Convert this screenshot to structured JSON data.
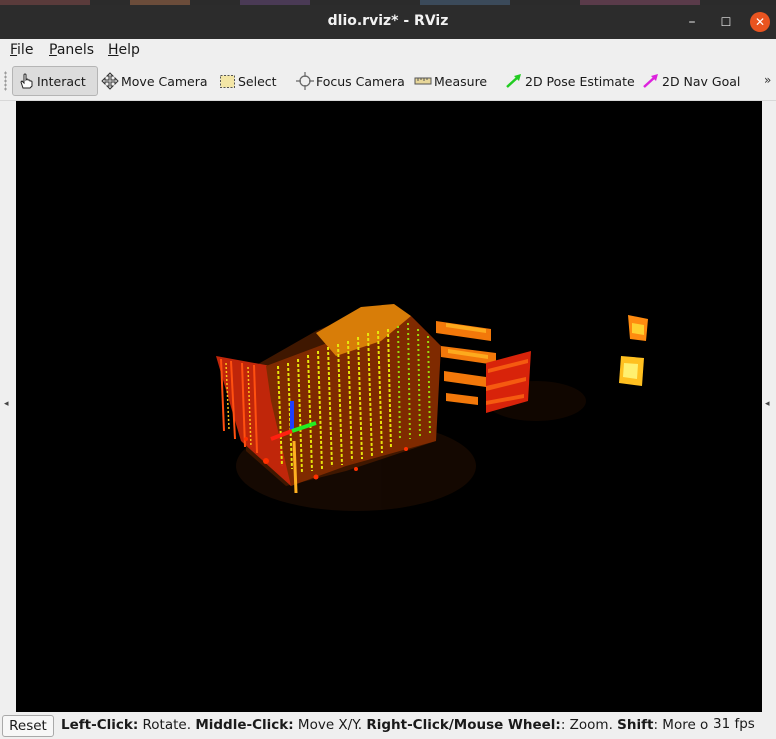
{
  "window": {
    "title": "dlio.rviz* - RViz"
  },
  "menubar": {
    "items": [
      {
        "label": "File",
        "mnemonic": "F",
        "rest": "ile"
      },
      {
        "label": "Panels",
        "mnemonic": "P",
        "rest": "anels"
      },
      {
        "label": "Help",
        "mnemonic": "H",
        "rest": "elp"
      }
    ]
  },
  "toolbar": {
    "tools": [
      {
        "label": "Interact",
        "icon": "hand-pointer-icon",
        "active": true
      },
      {
        "label": "Move Camera",
        "icon": "move-arrows-icon"
      },
      {
        "label": "Select",
        "icon": "select-box-icon"
      },
      {
        "label": "Focus Camera",
        "icon": "focus-crosshair-icon"
      },
      {
        "label": "Measure",
        "icon": "ruler-icon"
      },
      {
        "label": "2D Pose Estimate",
        "icon": "green-arrow-icon",
        "color": "#22cc22"
      },
      {
        "label": "2D Nav Goal",
        "icon": "magenta-arrow-icon",
        "color": "#dd22dd"
      }
    ],
    "overflow": "»"
  },
  "viewport": {
    "background": "#000000",
    "content": "pointcloud-render"
  },
  "statusbar": {
    "reset_label": "Reset",
    "help": {
      "k1": "Left-Click:",
      "v1": " Rotate. ",
      "k2": "Middle-Click:",
      "v2": " Move X/Y. ",
      "k3": "Right-Click/Mouse Wheel:",
      "v3": ": Zoom. ",
      "k4": "Shift",
      "v4": ": More opti"
    },
    "fps": "31 fps"
  }
}
